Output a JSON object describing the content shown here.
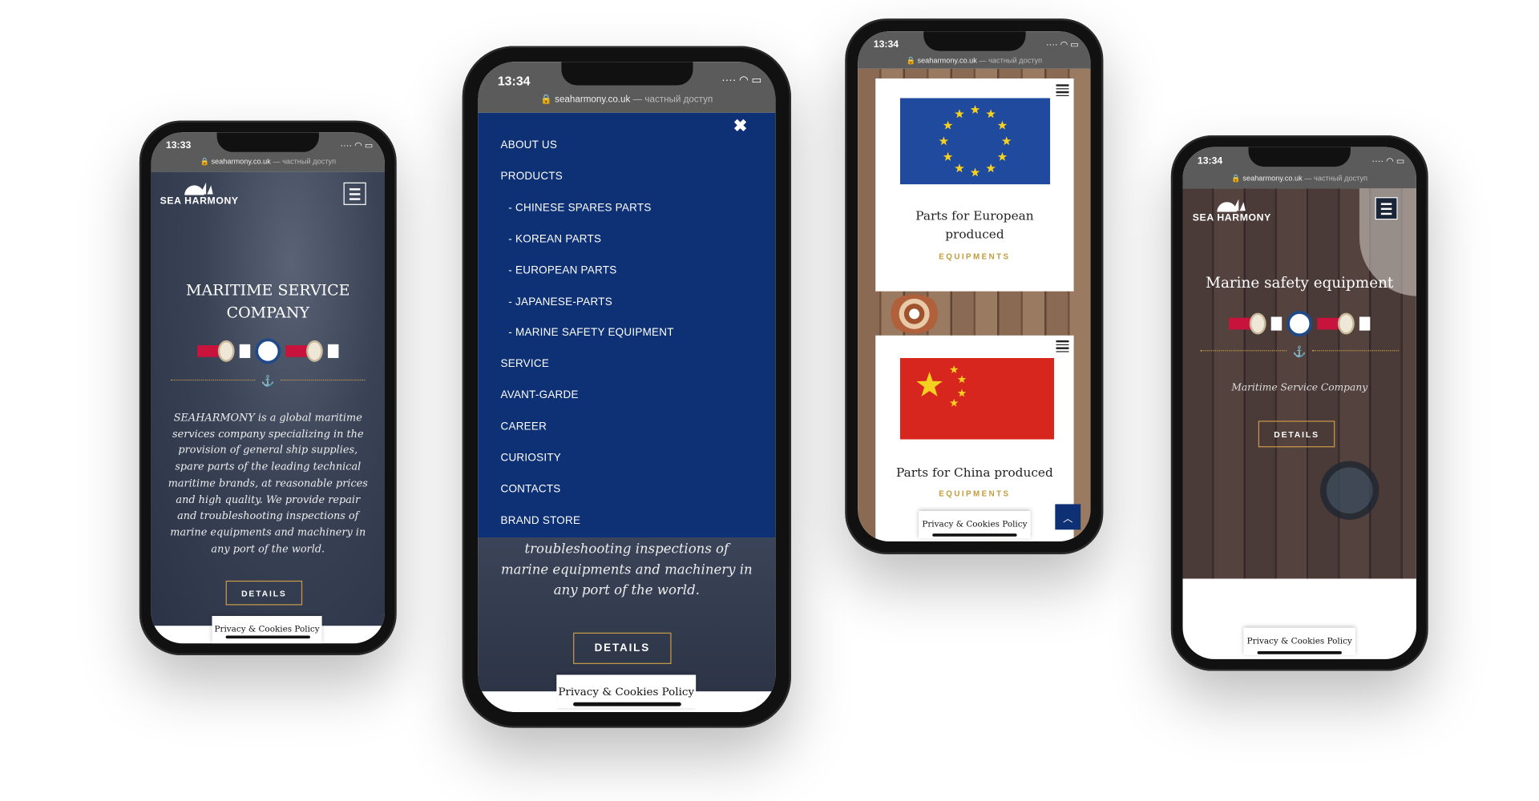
{
  "phones": [
    {
      "time": "13:33",
      "url_host": "seaharmony.co.uk",
      "url_suffix": " — частный доступ",
      "logo": "SEA HARMONY",
      "title": "MARITIME SERVICE COMPANY",
      "paragraph": "SEAHARMONY is a global maritime services company specializing in the provision of general ship supplies, spare parts of the leading technical maritime brands, at reasonable prices and high quality. We provide repair and troubleshooting inspections of marine equipments and machinery in any port of the world.",
      "details": "DETAILS",
      "privacy": "Privacy & Cookies Policy"
    },
    {
      "time": "13:34",
      "url_host": "seaharmony.co.uk",
      "url_suffix": " — частный доступ",
      "close_icon": "close-icon",
      "menu": [
        "ABOUT US",
        "PRODUCTS",
        "- CHINESE SPARES PARTS",
        "- KOREAN PARTS",
        "- EUROPEAN PARTS",
        "- JAPANESE-PARTS",
        "- MARINE SAFETY EQUIPMENT",
        "SERVICE",
        "AVANT-GARDE",
        "CAREER",
        "CURIOSITY",
        "CONTACTS",
        "BRAND STORE"
      ],
      "paragraph_tail": "troubleshooting inspections of marine equipments and machinery in any port of the world.",
      "details": "DETAILS",
      "privacy": "Privacy & Cookies Policy"
    },
    {
      "time": "13:34",
      "url_host": "seaharmony.co.uk",
      "url_suffix": " — частный доступ",
      "cards": [
        {
          "title": "Parts for European produced",
          "category": "EQUIPMENTS",
          "flag": "eu"
        },
        {
          "title": "Parts for China produced",
          "category": "EQUIPMENTS",
          "flag": "china"
        }
      ],
      "privacy": "Privacy & Cookies Policy",
      "scroll_top_icon": "chevron-up-icon"
    },
    {
      "time": "13:34",
      "url_host": "seaharmony.co.uk",
      "url_suffix": " — частный доступ",
      "logo": "SEA HARMONY",
      "title": "Marine safety equipment",
      "subtitle": "Maritime Service Company",
      "details": "DETAILS",
      "privacy": "Privacy & Cookies Policy"
    }
  ],
  "colors": {
    "menu_bg": "#0d3174",
    "accent_gold": "#c99a4a",
    "badge_red": "#c8143c"
  }
}
